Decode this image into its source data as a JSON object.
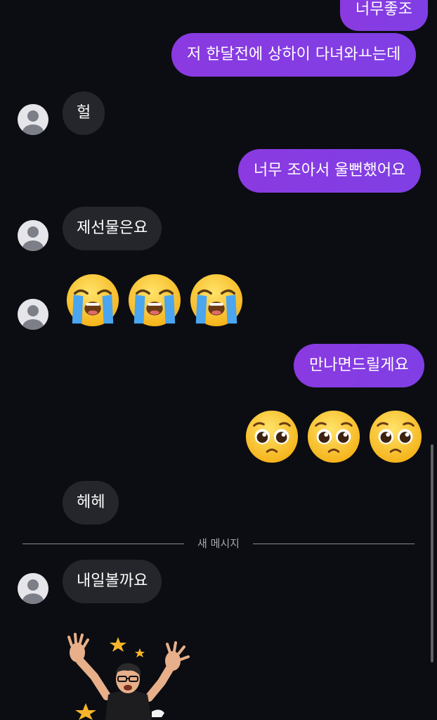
{
  "messages": [
    {
      "id": "m1",
      "side": "sent",
      "text": "너무좋조"
    },
    {
      "id": "m2",
      "side": "sent",
      "text": "저 한달전에 상하이 다녀와ㅛ는데"
    },
    {
      "id": "m3",
      "side": "received",
      "text": "헐"
    },
    {
      "id": "m4",
      "side": "sent",
      "text": "너무 조아서 울뻔했어요"
    },
    {
      "id": "m5",
      "side": "received",
      "text": "제선물은요"
    },
    {
      "id": "m6",
      "side": "received",
      "emoji": "loudly-crying-face",
      "count": 3
    },
    {
      "id": "m7",
      "side": "sent",
      "text": "만나면드릴게요"
    },
    {
      "id": "m8",
      "side": "sent",
      "emoji": "pleading-face",
      "count": 3
    },
    {
      "id": "m9",
      "side": "received",
      "text": "헤헤"
    },
    {
      "id": "m10",
      "side": "received",
      "text": "내일볼까요"
    },
    {
      "id": "m11",
      "side": "received",
      "sticker": "man-falling-with-stars"
    }
  ],
  "divider": {
    "label": "새 메시지"
  },
  "colors": {
    "background": "#0c0d12",
    "sent_bubble": "#8a3ae0",
    "received_bubble": "#25262b",
    "text": "#ffffff"
  }
}
